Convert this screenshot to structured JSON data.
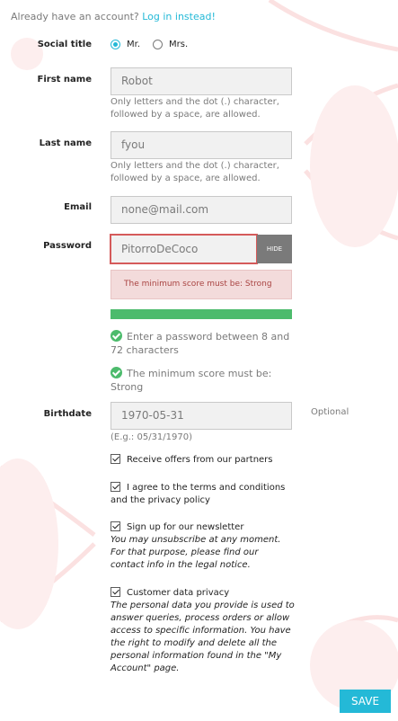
{
  "login": {
    "prompt": "Already have an account?",
    "link": "Log in instead!"
  },
  "social_title": {
    "label": "Social title",
    "options": [
      "Mr.",
      "Mrs."
    ],
    "selected": "Mr."
  },
  "first_name": {
    "label": "First name",
    "value": "Robot",
    "hint": "Only letters and the dot (.) character, followed by a space, are allowed."
  },
  "last_name": {
    "label": "Last name",
    "value": "fyou",
    "hint": "Only letters and the dot (.) character, followed by a space, are allowed."
  },
  "email": {
    "label": "Email",
    "value": "none@mail.com"
  },
  "password": {
    "label": "Password",
    "value": "PitorroDeCoco",
    "toggle_label": "HIDE",
    "error": "The minimum score must be: Strong",
    "strength": 1.0,
    "requirements": [
      "Enter a password between 8 and 72 characters",
      "The minimum score must be: Strong"
    ]
  },
  "birthdate": {
    "label": "Birthdate",
    "value": "1970-05-31",
    "hint": "(E.g.: 05/31/1970)",
    "optional": "Optional"
  },
  "checkboxes": {
    "partners": {
      "label": "Receive offers from our partners",
      "checked": true
    },
    "terms": {
      "label": "I agree to the terms and conditions and the privacy policy",
      "checked": true
    },
    "newsletter": {
      "label": "Sign up for our newsletter",
      "note": "You may unsubscribe at any moment. For that purpose, please find our contact info in the legal notice.",
      "checked": true
    },
    "privacy": {
      "label": "Customer data privacy",
      "note": "The personal data you provide is used to answer queries, process orders or allow access to specific information. You have the right to modify and delete all the personal information found in the \"My Account\" page.",
      "checked": true
    }
  },
  "save_label": "SAVE",
  "colors": {
    "accent": "#24b9d7",
    "success": "#4cbb6c",
    "error_bg": "#f3dbdb",
    "error_text": "#a94442",
    "error_border": "#d55a5a"
  }
}
